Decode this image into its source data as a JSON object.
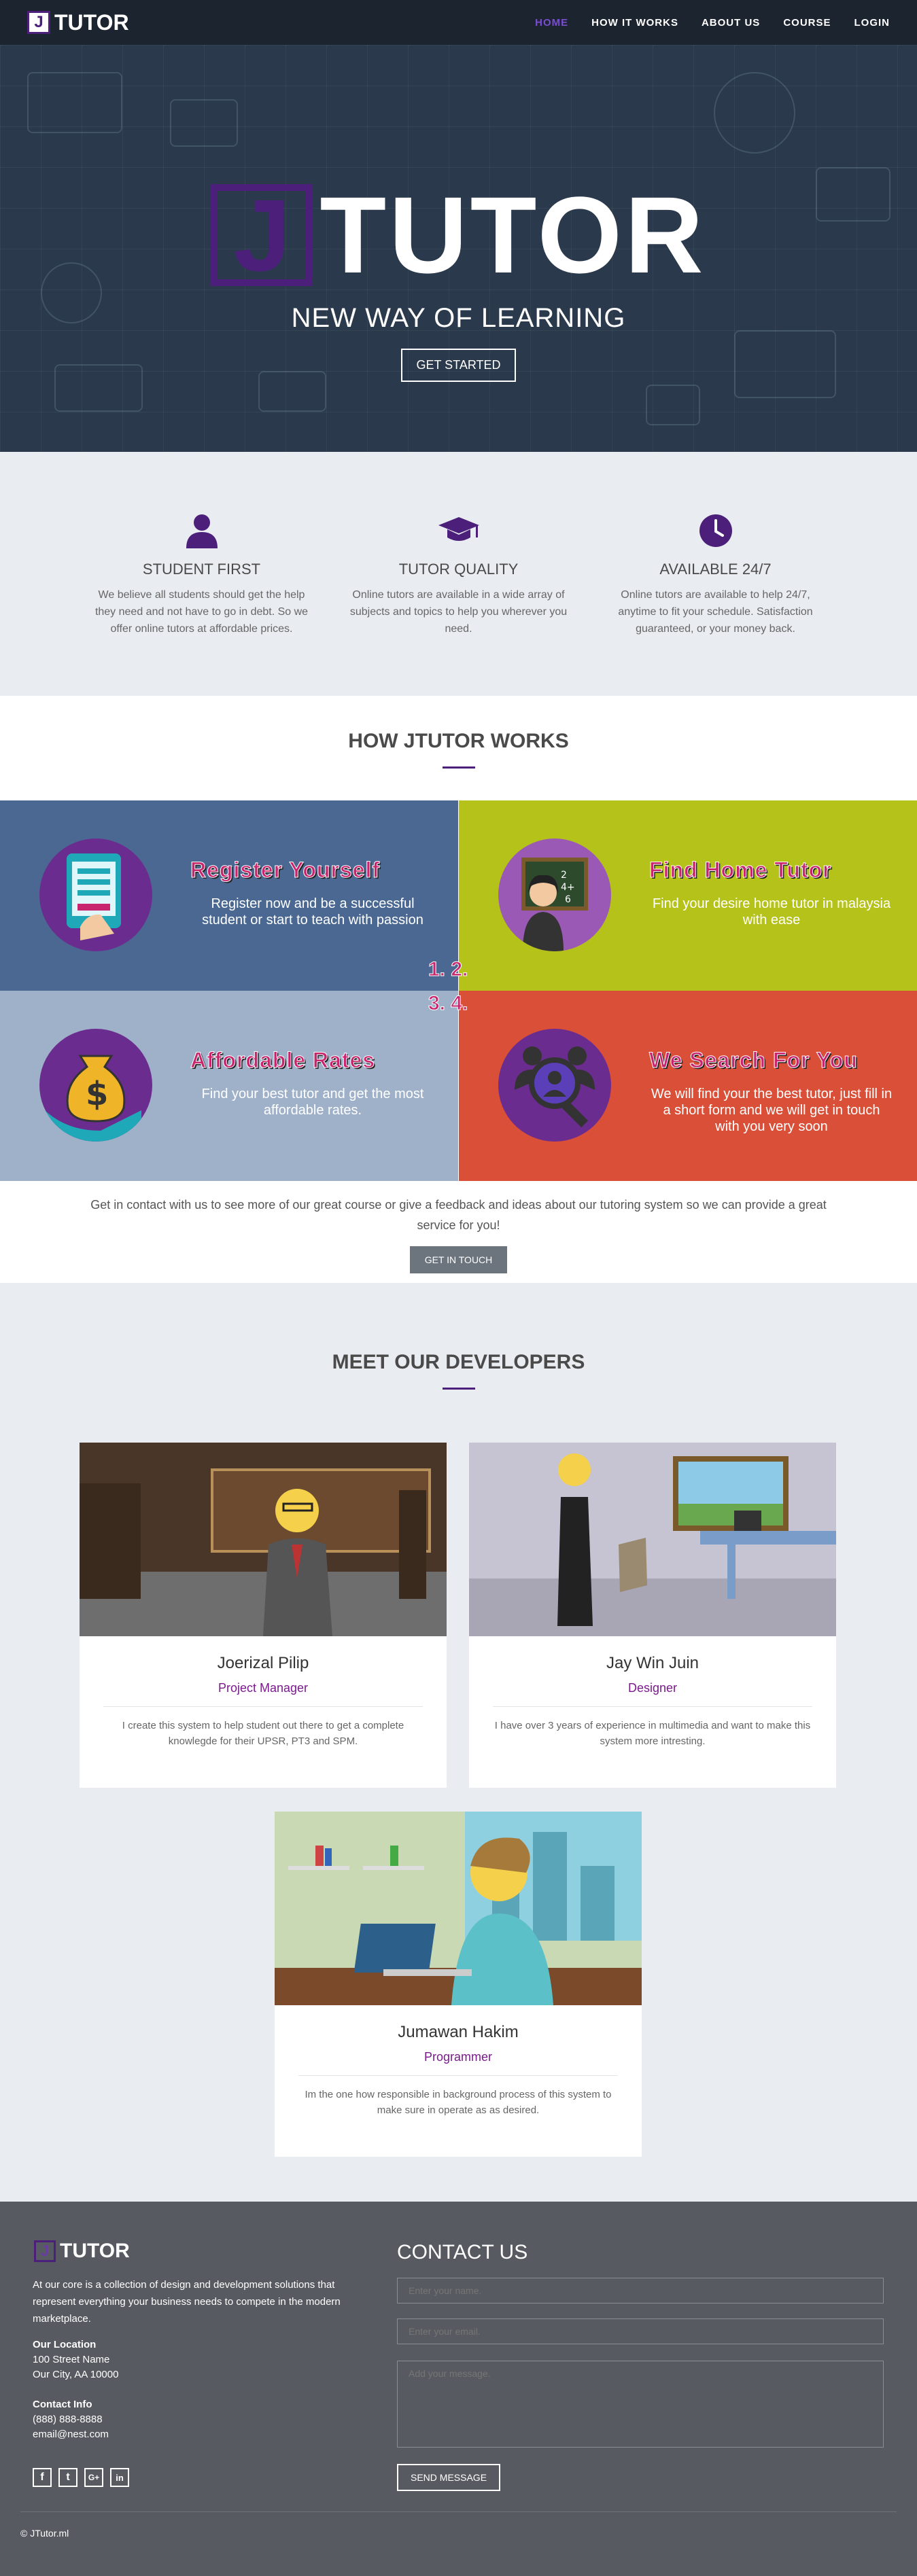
{
  "nav": {
    "brand": "TUTOR",
    "brand_j": "J",
    "items": [
      {
        "label": "HOME"
      },
      {
        "label": "HOW IT WORKS"
      },
      {
        "label": "ABOUT US"
      },
      {
        "label": "COURSE"
      },
      {
        "label": "LOGIN"
      }
    ]
  },
  "hero": {
    "logo_j": "J",
    "logo_word": "TUTOR",
    "tagline": "NEW WAY OF LEARNING",
    "cta": "GET STARTED"
  },
  "features": [
    {
      "icon": "user-icon",
      "title": "STUDENT FIRST",
      "text": "We believe all students should get the help they need and not have to go in debt. So we offer online tutors at affordable prices."
    },
    {
      "icon": "graduation-cap-icon",
      "title": "TUTOR QUALITY",
      "text": "Online tutors are available in a wide array of subjects and topics to help you wherever you need."
    },
    {
      "icon": "clock-icon",
      "title": "AVAILABLE 24/7",
      "text": "Online tutors are available to help 24/7, anytime to fit your schedule. Satisfaction guaranteed, or your money back."
    }
  ],
  "how": {
    "title": "HOW JTUTOR WORKS",
    "tiles": [
      {
        "title": "Register Yourself",
        "text": "Register now and be a successful student or start to teach with passion",
        "icon": "tablet-register-icon",
        "bg": "#4a6891"
      },
      {
        "title": "Find Home Tutor",
        "text": "Find your desire home tutor in malaysia with ease",
        "icon": "teacher-blackboard-icon",
        "bg": "#b5c219"
      },
      {
        "title": "Affordable Rates",
        "text": "Find your best tutor and get the most affordable rates.",
        "icon": "money-bag-icon",
        "bg": "#9fb1c9"
      },
      {
        "title": "We Search For You",
        "text": "We will find your the best tutor, just fill in a short form and we will get in touch with you very soon",
        "icon": "search-person-icon",
        "bg": "#d94f38"
      }
    ],
    "nums_top": "1. 2.",
    "nums_bottom": "3. 4.",
    "contact_text": "Get in contact with us to see more of our great course or give a feedback and ideas about our tutoring system so we can provide a great service for you!",
    "contact_btn": "GET IN TOUCH"
  },
  "developers": {
    "title": "MEET OUR DEVELOPERS",
    "people": [
      {
        "name": "Joerizal Pilip",
        "role": "Project Manager",
        "bio": "I create this system to help student out there to get a complete knowlegde for their UPSR, PT3 and SPM."
      },
      {
        "name": "Jay Win Juin",
        "role": "Designer",
        "bio": "I have over 3 years of experience in multimedia and want to make this system more intresting."
      },
      {
        "name": "Jumawan Hakim",
        "role": "Programmer",
        "bio": "Im the one how responsible in background process of this system to make sure in operate as as desired."
      }
    ]
  },
  "footer": {
    "brand_j": "J",
    "brand": "TUTOR",
    "about": "At our core is a collection of design and development solutions that represent everything your business needs to compete in the modern marketplace.",
    "location_title": "Our Location",
    "location_lines": [
      "100 Street Name",
      "Our City, AA 10000"
    ],
    "contact_title": "Contact Info",
    "phone": "(888) 888-8888",
    "email": "email@nest.com",
    "social": [
      "f",
      "t",
      "G+",
      "in"
    ],
    "contact_heading": "CONTACT US",
    "name_placeholder": "Enter your name.",
    "email_placeholder": "Enter your email.",
    "message_placeholder": "Add your message.",
    "send": "SEND MESSAGE",
    "copyright": "© JTutor.ml"
  },
  "colors": {
    "accent": "#4b1f7a",
    "nav_bg": "#1c2430",
    "footer_bg": "#575a60"
  }
}
